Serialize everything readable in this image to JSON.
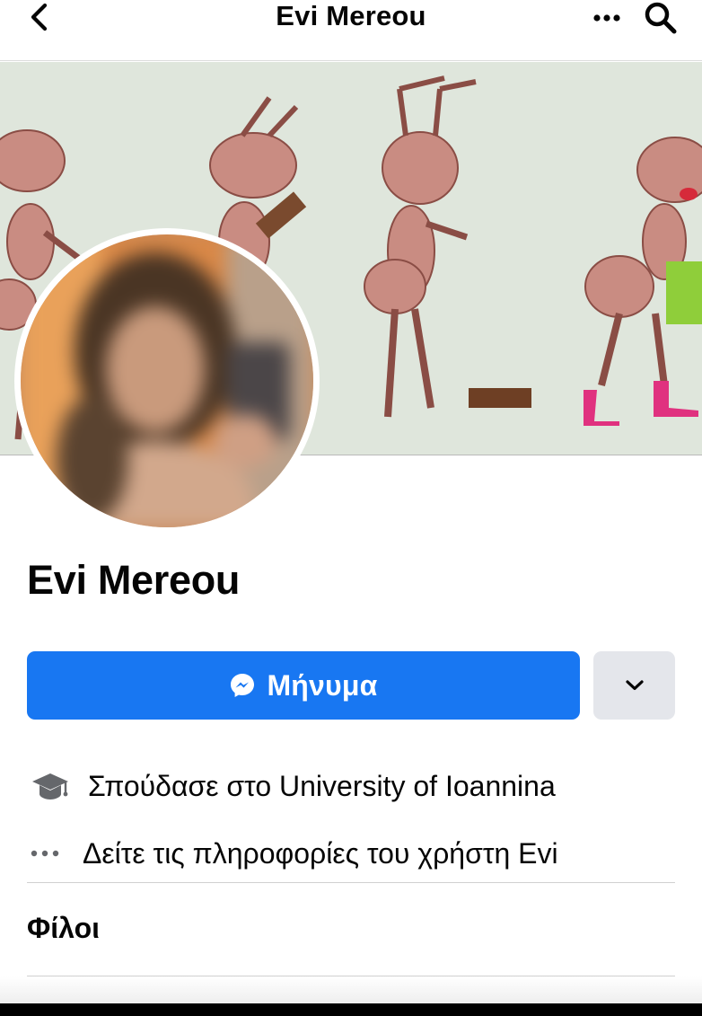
{
  "header": {
    "title": "Evi Mereou",
    "back_icon": "chevron-left-icon",
    "more_icon": "more-horizontal-icon",
    "search_icon": "search-icon"
  },
  "profile": {
    "name": "Evi Mereou",
    "cover_description_icon": "cover-photo",
    "avatar_icon": "profile-photo"
  },
  "actions": {
    "message_label": "Μήνυμα",
    "message_icon": "messenger-icon",
    "dropdown_icon": "chevron-down-icon"
  },
  "info": {
    "education": "Σπούδασε στο University of Ioannina",
    "education_icon": "graduation-cap-icon",
    "see_about": "Δείτε τις πληροφορίες του χρήστη Evi",
    "see_about_icon": "more-horizontal-icon"
  },
  "friends": {
    "title": "Φίλοι"
  },
  "colors": {
    "primary": "#1877f2",
    "secondary_button": "#e4e6eb",
    "text": "#050505",
    "icon_gray": "#65676b"
  }
}
